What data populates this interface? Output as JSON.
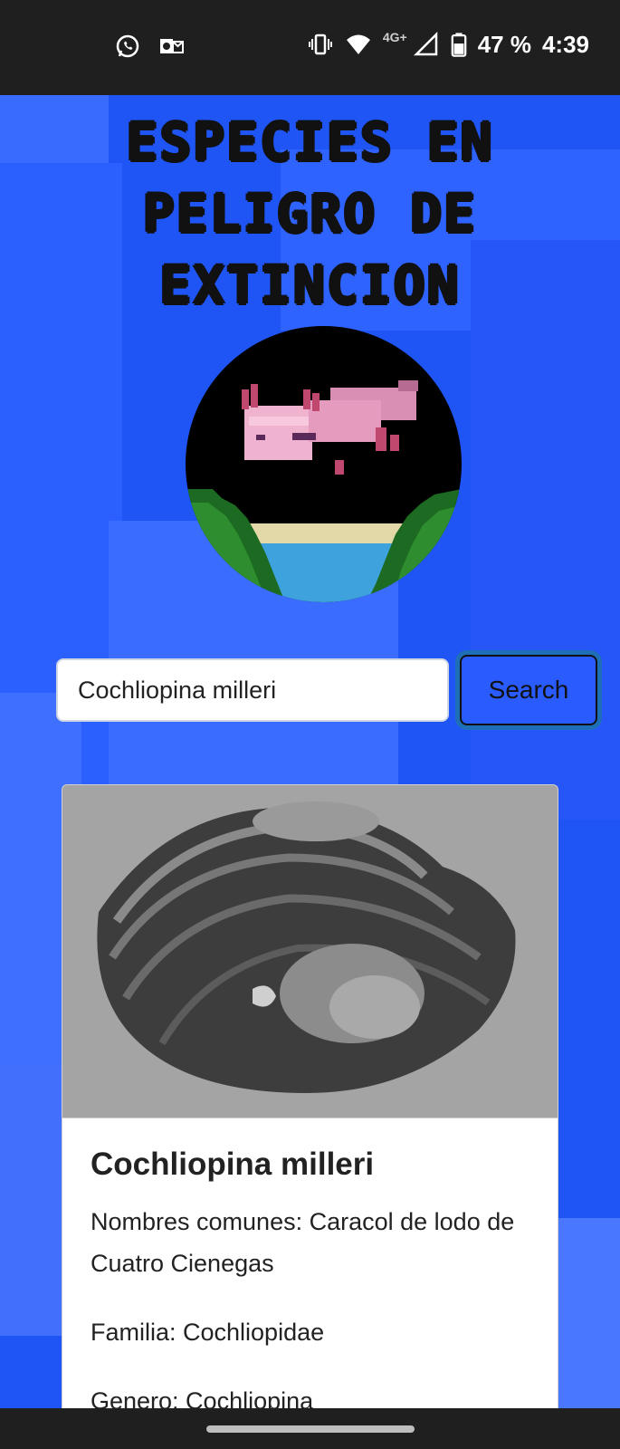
{
  "status_bar": {
    "battery_percent": "47 %",
    "time": "4:39",
    "network": "4G+",
    "icons": [
      "whatsapp-icon",
      "outlook-icon",
      "vibrate-icon",
      "wifi-icon",
      "signal-icon",
      "battery-icon"
    ]
  },
  "page": {
    "title_lines": [
      "ESPECIES EN",
      "PELIGRO DE",
      "EXTINCION"
    ],
    "logo": "axolotl-logo"
  },
  "search": {
    "value": "Cochliopina milleri",
    "button_label": "Search"
  },
  "result_card": {
    "image": "snail-shell-photo",
    "title": "Cochliopina milleri",
    "common_names": "Nombres comunes: Caracol de lodo de Cuatro Cienegas",
    "family": "Familia: Cochliopidae",
    "genus": "Genero: Cochliopina"
  },
  "colors": {
    "background": "#1f55f5",
    "button": "#2a5bff",
    "status_bar": "#1f1f1f"
  }
}
